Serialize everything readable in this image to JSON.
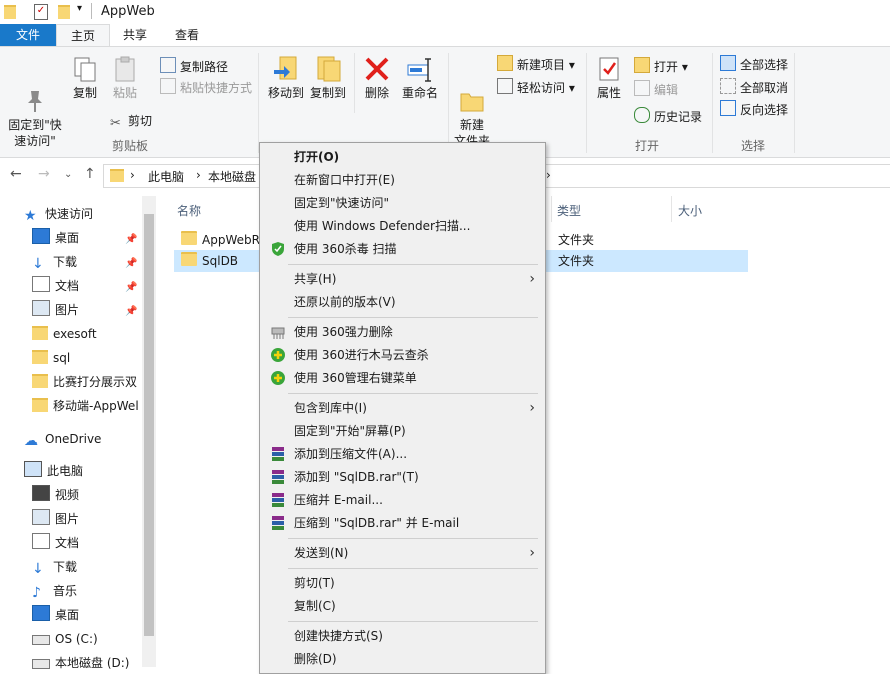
{
  "window": {
    "title": "AppWeb"
  },
  "tabs": [
    "文件",
    "主页",
    "共享",
    "查看"
  ],
  "ribbon": {
    "clipboard": {
      "pin": "固定到\"快\n速访问\"",
      "copy": "复制",
      "paste": "粘贴",
      "copy_path": "复制路径",
      "paste_shortcut": "粘贴快捷方式",
      "cut": "剪切",
      "group": "剪贴板"
    },
    "organize": {
      "move_to": "移动到",
      "copy_to": "复制到",
      "delete": "删除",
      "rename": "重命名"
    },
    "new": {
      "new_folder": "新建\n文件夹",
      "new_item": "新建项目",
      "easy_access": "轻松访问"
    },
    "open": {
      "properties": "属性",
      "open": "打开",
      "edit": "编辑",
      "history": "历史记录",
      "group": "打开"
    },
    "select": {
      "select_all": "全部选择",
      "select_none": "全部取消",
      "invert": "反向选择",
      "group": "选择"
    }
  },
  "address": {
    "crumbs": [
      "此电脑",
      "本地磁盘"
    ]
  },
  "leftnav": {
    "quick_access": "快速访问",
    "items": [
      "桌面",
      "下载",
      "文档",
      "图片",
      "exesoft",
      "sql",
      "比赛打分展示双",
      "移动端-AppWel"
    ],
    "onedrive": "OneDrive",
    "this_pc": "此电脑",
    "pc_items": [
      "视频",
      "图片",
      "文档",
      "下载",
      "音乐",
      "桌面",
      "OS (C:)",
      "本地磁盘 (D:)"
    ]
  },
  "columns": {
    "name": "名称",
    "type": "类型",
    "size": "大小"
  },
  "files": [
    {
      "name": "AppWebRe",
      "type": "文件夹"
    },
    {
      "name": "SqlDB",
      "type": "文件夹"
    }
  ],
  "context_menu": {
    "open": "打开(O)",
    "open_new": "在新窗口中打开(E)",
    "pin_quick": "固定到\"快速访问\"",
    "defender": "使用 Windows Defender扫描...",
    "scan360": "使用 360杀毒 扫描",
    "share": "共享(H)",
    "restore": "还原以前的版本(V)",
    "del360": "使用 360强力删除",
    "trojan360": "使用 360进行木马云查杀",
    "manage360": "使用 360管理右键菜单",
    "library": "包含到库中(I)",
    "pin_start": "固定到\"开始\"屏幕(P)",
    "add_archive": "添加到压缩文件(A)...",
    "add_rar": "添加到 \"SqlDB.rar\"(T)",
    "email": "压缩并 E-mail...",
    "rar_email": "压缩到 \"SqlDB.rar\" 并 E-mail",
    "send_to": "发送到(N)",
    "cut": "剪切(T)",
    "copy": "复制(C)",
    "shortcut": "创建快捷方式(S)",
    "delete": "删除(D)"
  }
}
